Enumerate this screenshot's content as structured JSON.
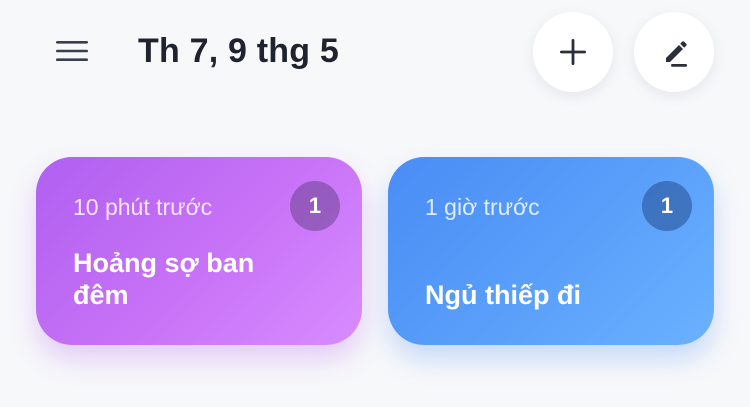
{
  "header": {
    "date_title": "Th 7, 9 thg 5"
  },
  "icons": {
    "menu": "hamburger-menu-icon",
    "add": "plus-icon",
    "edit": "pencil-icon"
  },
  "colors": {
    "background": "#f7f8fa",
    "title_text": "#1f2330",
    "purple_card": "#c06af4",
    "blue_card": "#5a9ef9"
  },
  "cards": [
    {
      "time_ago": "10 phút trước",
      "count": "1",
      "title": "Hoảng sợ ban đêm"
    },
    {
      "time_ago": "1 giờ trước",
      "count": "1",
      "title": "Ngủ thiếp đi"
    }
  ]
}
